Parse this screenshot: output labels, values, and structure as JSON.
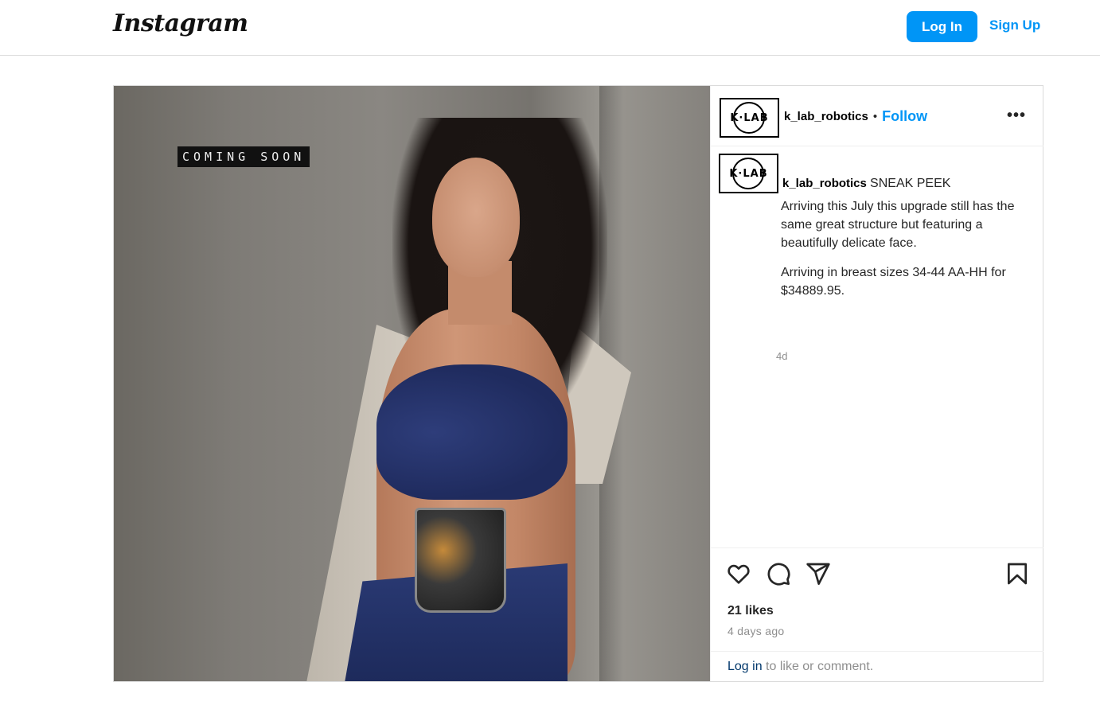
{
  "nav": {
    "logo": "Instagram",
    "login_label": "Log In",
    "signup_label": "Sign Up",
    "accent_color": "#0095f6"
  },
  "media": {
    "overlay_text": "COMING SOON"
  },
  "post": {
    "avatar_text": "K·LAB",
    "username": "k_lab_robotics",
    "separator": "•",
    "follow_label": "Follow",
    "more_icon": "more-horizontal-icon",
    "caption": {
      "username": "k_lab_robotics",
      "lead": "SNEAK PEEK",
      "paragraph_1": "Arriving this July this upgrade still has the same great structure but featuring a beautifully delicate face.",
      "paragraph_2": "Arriving in breast sizes 34-44 AA-HH for $34889.95.",
      "time": "4d"
    },
    "actions": {
      "like_icon": "heart-icon",
      "comment_icon": "comment-icon",
      "share_icon": "send-icon",
      "save_icon": "bookmark-icon"
    },
    "likes": "21 likes",
    "posted": "4 days ago",
    "login_prompt": {
      "link": "Log in",
      "rest": " to like or comment."
    }
  }
}
